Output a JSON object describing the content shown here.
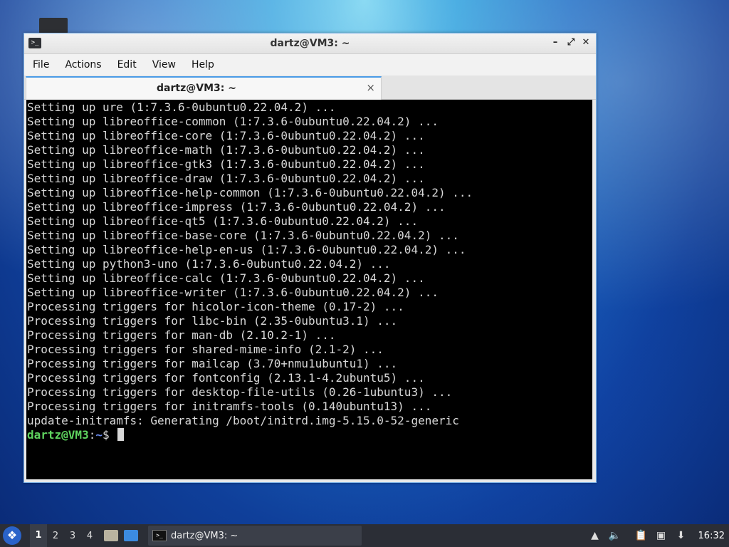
{
  "window": {
    "title": "dartz@VM3: ~",
    "menu": [
      "File",
      "Actions",
      "Edit",
      "View",
      "Help"
    ],
    "tab_label": "dartz@VM3: ~",
    "buttons": {
      "minimize": "–",
      "maximize": "⤢",
      "close": "✕",
      "tab_close": "×"
    }
  },
  "terminal": {
    "lines": [
      "Setting up ure (1:7.3.6-0ubuntu0.22.04.2) ...",
      "Setting up libreoffice-common (1:7.3.6-0ubuntu0.22.04.2) ...",
      "Setting up libreoffice-core (1:7.3.6-0ubuntu0.22.04.2) ...",
      "Setting up libreoffice-math (1:7.3.6-0ubuntu0.22.04.2) ...",
      "Setting up libreoffice-gtk3 (1:7.3.6-0ubuntu0.22.04.2) ...",
      "Setting up libreoffice-draw (1:7.3.6-0ubuntu0.22.04.2) ...",
      "Setting up libreoffice-help-common (1:7.3.6-0ubuntu0.22.04.2) ...",
      "Setting up libreoffice-impress (1:7.3.6-0ubuntu0.22.04.2) ...",
      "Setting up libreoffice-qt5 (1:7.3.6-0ubuntu0.22.04.2) ...",
      "Setting up libreoffice-base-core (1:7.3.6-0ubuntu0.22.04.2) ...",
      "Setting up libreoffice-help-en-us (1:7.3.6-0ubuntu0.22.04.2) ...",
      "Setting up python3-uno (1:7.3.6-0ubuntu0.22.04.2) ...",
      "Setting up libreoffice-calc (1:7.3.6-0ubuntu0.22.04.2) ...",
      "Setting up libreoffice-writer (1:7.3.6-0ubuntu0.22.04.2) ...",
      "Processing triggers for hicolor-icon-theme (0.17-2) ...",
      "Processing triggers for libc-bin (2.35-0ubuntu3.1) ...",
      "Processing triggers for man-db (2.10.2-1) ...",
      "Processing triggers for shared-mime-info (2.1-2) ...",
      "Processing triggers for mailcap (3.70+nmu1ubuntu1) ...",
      "Processing triggers for fontconfig (2.13.1-4.2ubuntu5) ...",
      "Processing triggers for desktop-file-utils (0.26-1ubuntu3) ...",
      "Processing triggers for initramfs-tools (0.140ubuntu13) ...",
      "update-initramfs: Generating /boot/initrd.img-5.15.0-52-generic"
    ],
    "prompt_user": "dartz@VM3",
    "prompt_sep": ":",
    "prompt_path": "~",
    "prompt_symbol": "$"
  },
  "taskbar": {
    "workspaces": [
      "1",
      "2",
      "3",
      "4"
    ],
    "task_label": "dartz@VM3: ~",
    "clock": "16:32"
  },
  "colors": {
    "prompt_user": "#5fd35f",
    "prompt_path": "#6a8cf0",
    "accent": "#4a9be6"
  }
}
